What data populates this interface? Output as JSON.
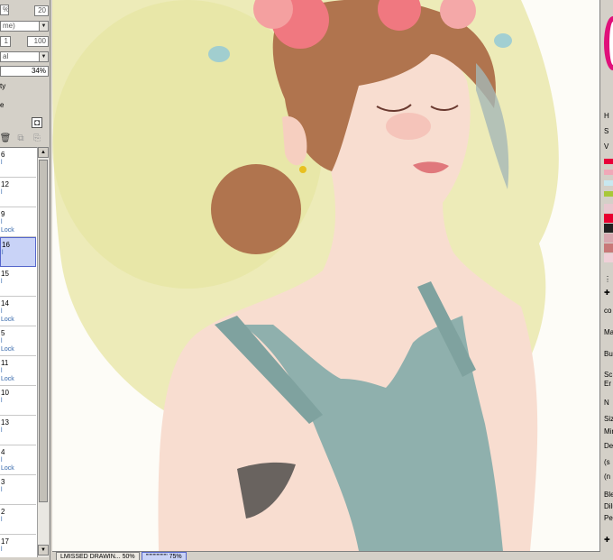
{
  "properties": {
    "percent_sign": "%",
    "field_20": "20",
    "field_1": "1",
    "field_100": "100",
    "mode_dropdown": "me)",
    "blend_dropdown": "al",
    "opacity_value": "34%",
    "opacity_label": "ty",
    "extra_label": "e"
  },
  "layers": [
    {
      "num": "6",
      "sub": "l",
      "lock": ""
    },
    {
      "num": "12",
      "sub": "l",
      "lock": ""
    },
    {
      "num": "9",
      "sub": "l",
      "lock": "Lock"
    },
    {
      "num": "16",
      "sub": "l",
      "lock": ""
    },
    {
      "num": "15",
      "sub": "l",
      "lock": ""
    },
    {
      "num": "14",
      "sub": "l",
      "lock": "Lock"
    },
    {
      "num": "5",
      "sub": "l",
      "lock": "Lock"
    },
    {
      "num": "11",
      "sub": "l",
      "lock": "Lock"
    },
    {
      "num": "10",
      "sub": "l",
      "lock": ""
    },
    {
      "num": "13",
      "sub": "l",
      "lock": ""
    },
    {
      "num": "4",
      "sub": "l",
      "lock": "Lock"
    },
    {
      "num": "3",
      "sub": "l",
      "lock": ""
    },
    {
      "num": "2",
      "sub": "l",
      "lock": ""
    },
    {
      "num": "17",
      "sub": "l",
      "lock": ""
    }
  ],
  "selected_layer_index": 3,
  "tabs": [
    {
      "label": "LMISSED DRAWIN... 50%"
    },
    {
      "label": "'''''''''''''''''' 75%"
    }
  ],
  "color_panel": {
    "h_label": "H",
    "s_label": "S",
    "v_label": "V",
    "slider_colors": [
      "#e8003a",
      "#f0a8b8",
      "#c8e8f0",
      "#a8c838"
    ],
    "palette": [
      "#e8c8d0",
      "#e80030",
      "#202020",
      "#d8a8b0",
      "#c87878",
      "#f0d0d8"
    ]
  },
  "tool_panel": {
    "label_co": "co",
    "label_ma": "Ma",
    "label_bu": "Bu",
    "label_sc": "Sc",
    "label_er": "Er",
    "label_n": "N",
    "label_siz": "Siz",
    "label_min": "Min",
    "label_den": "Den",
    "label_s": "(s",
    "label_n2": "(n",
    "label_ble": "Ble",
    "label_dil": "Dilu",
    "label_per": "Per"
  },
  "canvas": {
    "background_color": "#fdfcf7",
    "wash_color": "#e8e6a8",
    "dress_color": "#8fb0ad",
    "hair_color": "#b0744e",
    "skin_color": "#f8ddd0",
    "flower_color": "#f07880"
  }
}
